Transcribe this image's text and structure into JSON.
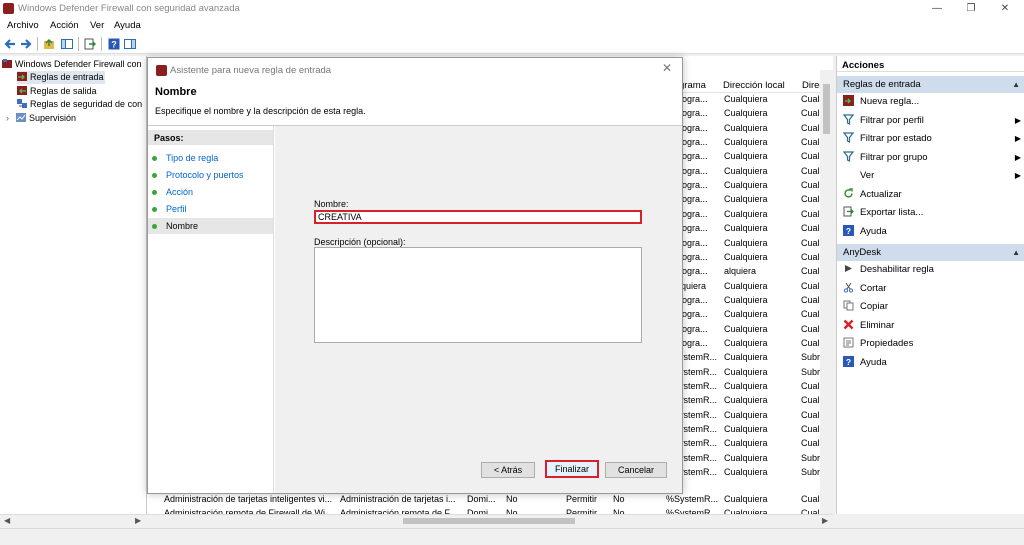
{
  "window": {
    "title": "Windows Defender Firewall con seguridad avanzada"
  },
  "menu": [
    "Archivo",
    "Acción",
    "Ver",
    "Ayuda"
  ],
  "tree": {
    "root": "Windows Defender Firewall con",
    "items": [
      "Reglas de entrada",
      "Reglas de salida",
      "Reglas de seguridad de con",
      "Supervisión"
    ]
  },
  "rules": {
    "columns": {
      "programa": "grama",
      "direccion_local": "Dirección local",
      "direccion_remota": "Direc"
    },
    "rows": [
      [
        "rogra...",
        "Cualquiera",
        "Cual"
      ],
      [
        "rogra...",
        "Cualquiera",
        "Cual"
      ],
      [
        "rogra...",
        "Cualquiera",
        "Cual"
      ],
      [
        "rogra...",
        "Cualquiera",
        "Cual"
      ],
      [
        "rogra...",
        "Cualquiera",
        "Cual"
      ],
      [
        "rogra...",
        "Cualquiera",
        "Cual"
      ],
      [
        "rogra...",
        "Cualquiera",
        "Cual"
      ],
      [
        "rogra...",
        "Cualquiera",
        "Cual"
      ],
      [
        "rogra...",
        "Cualquiera",
        "Cual"
      ],
      [
        "rogra...",
        "Cualquiera",
        "Cual"
      ],
      [
        "rogra...",
        "Cualquiera",
        "Cual"
      ],
      [
        "rogra...",
        "Cualquiera",
        "Cual"
      ],
      [
        "rogra...",
        "alquiera",
        "Cual"
      ],
      [
        "lquiera",
        "Cualquiera",
        "Cual"
      ],
      [
        "rogra...",
        "Cualquiera",
        "Cual"
      ],
      [
        "rogra...",
        "Cualquiera",
        "Cual"
      ],
      [
        "rogra...",
        "Cualquiera",
        "Cual"
      ],
      [
        "rogra...",
        "Cualquiera",
        "Cual"
      ],
      [
        "ystemR...",
        "Cualquiera",
        "Subr"
      ],
      [
        "ystemR...",
        "Cualquiera",
        "Subr"
      ],
      [
        "ystemR...",
        "Cualquiera",
        "Cual"
      ],
      [
        "ystemR...",
        "Cualquiera",
        "Cual"
      ],
      [
        "ystemR...",
        "Cualquiera",
        "Cual"
      ],
      [
        "ystemR...",
        "Cualquiera",
        "Cual"
      ],
      [
        "ystemR...",
        "Cualquiera",
        "Cual"
      ],
      [
        "ystemR...",
        "Cualquiera",
        "Subr"
      ],
      [
        "ystemR...",
        "Cualquiera",
        "Subr"
      ]
    ],
    "bottom_rows": [
      [
        "Administración de tarjetas inteligentes vi...",
        "Administración de tarjetas i...",
        "Domi...",
        "No",
        "Permitir",
        "No",
        "%SystemR...",
        "Cualquiera",
        "Cual"
      ],
      [
        "Administración remota de Firewall de Wi...",
        "Administración remota de F...",
        "Domi...",
        "No",
        "Permitir",
        "No",
        "%SystemR...",
        "Cualquiera",
        "Cual"
      ]
    ]
  },
  "actions": {
    "title": "Acciones",
    "sections": [
      {
        "name": "Reglas de entrada",
        "items": [
          {
            "label": "Nueva regla...",
            "icon": "new-rule-icon",
            "sub": false
          },
          {
            "label": "Filtrar por perfil",
            "icon": "filter-icon",
            "sub": true
          },
          {
            "label": "Filtrar por estado",
            "icon": "filter-icon",
            "sub": true
          },
          {
            "label": "Filtrar por grupo",
            "icon": "filter-icon",
            "sub": true
          },
          {
            "label": "Ver",
            "icon": "",
            "sub": true
          },
          {
            "label": "Actualizar",
            "icon": "refresh-icon",
            "sub": false
          },
          {
            "label": "Exportar lista...",
            "icon": "export-icon",
            "sub": false
          },
          {
            "label": "Ayuda",
            "icon": "help-icon",
            "sub": false
          }
        ]
      },
      {
        "name": "AnyDesk",
        "items": [
          {
            "label": "Deshabilitar regla",
            "icon": "disable-icon",
            "sub": false
          },
          {
            "label": "Cortar",
            "icon": "cut-icon",
            "sub": false
          },
          {
            "label": "Copiar",
            "icon": "copy-icon",
            "sub": false
          },
          {
            "label": "Eliminar",
            "icon": "delete-icon",
            "sub": false
          },
          {
            "label": "Propiedades",
            "icon": "properties-icon",
            "sub": false
          },
          {
            "label": "Ayuda",
            "icon": "help-icon",
            "sub": false
          }
        ]
      }
    ]
  },
  "dialog": {
    "title": "Asistente para nueva regla de entrada",
    "heading": "Nombre",
    "subtitle": "Especifique el nombre y la descripción de esta regla.",
    "steps_title": "Pasos:",
    "steps": [
      "Tipo de regla",
      "Protocolo y puertos",
      "Acción",
      "Perfil",
      "Nombre"
    ],
    "name_label": "Nombre:",
    "name_value": "CREATIVA",
    "desc_label": "Descripción (opcional):",
    "desc_value": "",
    "back": "< Atrás",
    "finish": "Finalizar",
    "cancel": "Cancelar"
  },
  "colors": {
    "highlight": "#d6202a",
    "section": "#cfdceb",
    "link": "#0066cc",
    "step_dot": "#3aa63a"
  }
}
